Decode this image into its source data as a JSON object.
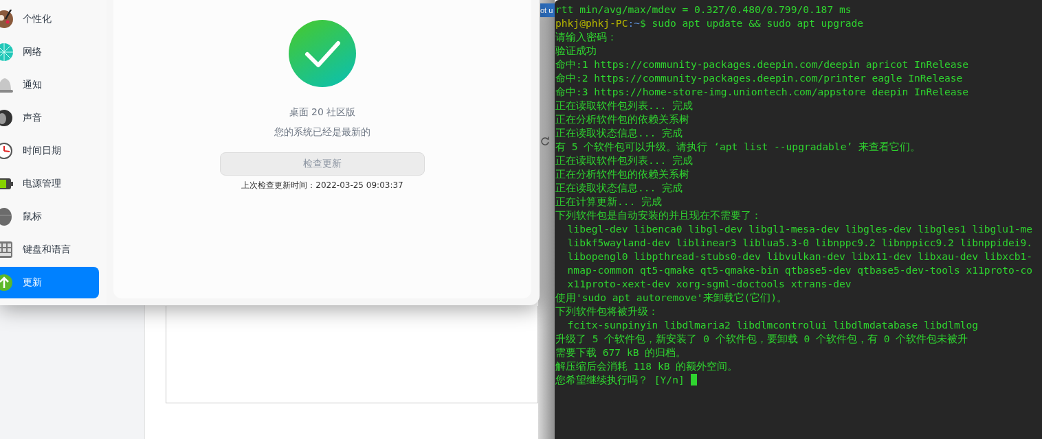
{
  "background_window": {
    "tab_label": "ot u"
  },
  "settings": {
    "sidebar": {
      "items": [
        {
          "label": "个性化",
          "selected": false
        },
        {
          "label": "网络",
          "selected": false
        },
        {
          "label": "通知",
          "selected": false
        },
        {
          "label": "声音",
          "selected": false
        },
        {
          "label": "时间日期",
          "selected": false
        },
        {
          "label": "电源管理",
          "selected": false
        },
        {
          "label": "鼠标",
          "selected": false
        },
        {
          "label": "键盘和语言",
          "selected": false
        },
        {
          "label": "更新",
          "selected": true
        }
      ]
    },
    "update": {
      "edition": "桌面 20 社区版",
      "status": "您的系统已经是最新的",
      "check_button": "检查更新",
      "last_check": "上次检查更新时间：2022-03-25 09:03:37"
    }
  },
  "terminal": {
    "lines": [
      {
        "kind": "output",
        "text": "rtt min/avg/max/mdev = 0.327/0.480/0.799/0.187 ms"
      },
      {
        "kind": "prompt",
        "user": "phkj@phkj-PC",
        "path": ":~",
        "command": "$ sudo apt update && sudo apt upgrade"
      },
      {
        "kind": "output",
        "text": "请输入密码："
      },
      {
        "kind": "output",
        "text": "验证成功"
      },
      {
        "kind": "output",
        "text": "命中:1 https://community-packages.deepin.com/deepin apricot InRelease"
      },
      {
        "kind": "output",
        "text": "命中:2 https://community-packages.deepin.com/printer eagle InRelease"
      },
      {
        "kind": "output",
        "text": "命中:3 https://home-store-img.uniontech.com/appstore deepin InRelease"
      },
      {
        "kind": "output",
        "text": "正在读取软件包列表... 完成"
      },
      {
        "kind": "output",
        "text": "正在分析软件包的依赖关系树"
      },
      {
        "kind": "output",
        "text": "正在读取状态信息... 完成"
      },
      {
        "kind": "output",
        "text": "有 5 个软件包可以升级。请执行 ‘apt list --upgradable’ 来查看它们。"
      },
      {
        "kind": "output",
        "text": "正在读取软件包列表... 完成"
      },
      {
        "kind": "output",
        "text": "正在分析软件包的依赖关系树"
      },
      {
        "kind": "output",
        "text": "正在读取状态信息... 完成"
      },
      {
        "kind": "output",
        "text": "正在计算更新... 完成"
      },
      {
        "kind": "output",
        "text": "下列软件包是自动安装的并且现在不需要了："
      },
      {
        "kind": "output",
        "text": "  libegl-dev libenca0 libgl-dev libgl1-mesa-dev libgles-dev libgles1 libglu1-me"
      },
      {
        "kind": "output",
        "text": "  libkf5wayland-dev liblinear3 liblua5.3-0 libnppc9.2 libnppicc9.2 libnppidei9."
      },
      {
        "kind": "output",
        "text": "  libopengl0 libpthread-stubs0-dev libvulkan-dev libx11-dev libxau-dev libxcb1-"
      },
      {
        "kind": "output",
        "text": "  nmap-common qt5-qmake qt5-qmake-bin qtbase5-dev qtbase5-dev-tools x11proto-co"
      },
      {
        "kind": "output",
        "text": "  x11proto-xext-dev xorg-sgml-doctools xtrans-dev"
      },
      {
        "kind": "output",
        "text": "使用'sudo apt autoremove'来卸载它(它们)。"
      },
      {
        "kind": "output",
        "text": "下列软件包将被升级："
      },
      {
        "kind": "output",
        "text": "  fcitx-sunpinyin libdlmaria2 libdlmcontrolui libdlmdatabase libdlmlog"
      },
      {
        "kind": "output",
        "text": "升级了 5 个软件包，新安装了 0 个软件包，要卸载 0 个软件包，有 0 个软件包未被升"
      },
      {
        "kind": "output",
        "text": "需要下载 677 kB 的归档。"
      },
      {
        "kind": "output",
        "text": "解压缩后会消耗 118 kB 的额外空间。"
      },
      {
        "kind": "input",
        "text": "您希望继续执行吗？ [Y/n] ",
        "cursor": true
      }
    ]
  }
}
